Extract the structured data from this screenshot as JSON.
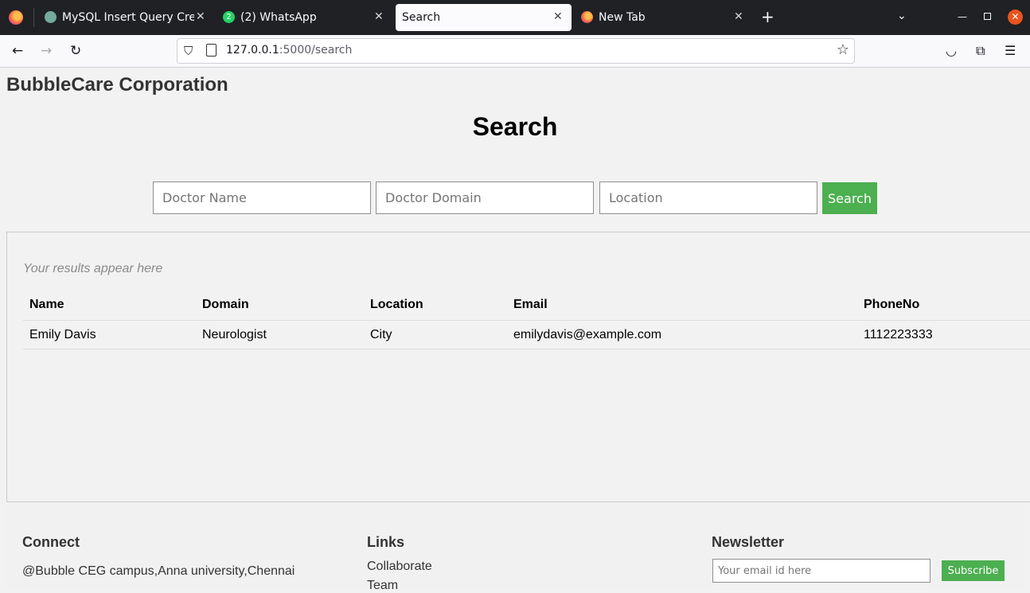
{
  "browser": {
    "tabs": [
      {
        "title": "MySQL Insert Query Crea",
        "favicon_color": "#74aa9c"
      },
      {
        "title": "(2) WhatsApp",
        "favicon_color": "#25d366"
      },
      {
        "title": "Search",
        "favicon_color": ""
      },
      {
        "title": "New Tab",
        "favicon_color": "#ff7139"
      }
    ],
    "address": {
      "host": "127.0.0.1",
      "path": ":5000/search"
    }
  },
  "page": {
    "brand": "BubbleCare Corporation",
    "heading": "Search",
    "search": {
      "doctor_name_placeholder": "Doctor Name",
      "doctor_domain_placeholder": "Doctor Domain",
      "location_placeholder": "Location",
      "button": "Search"
    },
    "results": {
      "hint": "Your results appear here",
      "columns": [
        "Name",
        "Domain",
        "Location",
        "Email",
        "PhoneNo"
      ],
      "rows": [
        [
          "Emily Davis",
          "Neurologist",
          "City",
          "emilydavis@example.com",
          "1112223333"
        ]
      ]
    },
    "footer": {
      "connect_title": "Connect",
      "connect_text": "@Bubble CEG campus,Anna university,Chennai",
      "links_title": "Links",
      "links": [
        "Collaborate",
        "Team"
      ],
      "newsletter_title": "Newsletter",
      "email_placeholder": "Your email id here",
      "subscribe": "Subscribe"
    }
  },
  "colors": {
    "accent": "#4caf50",
    "page_bg": "#f2f2f2"
  }
}
